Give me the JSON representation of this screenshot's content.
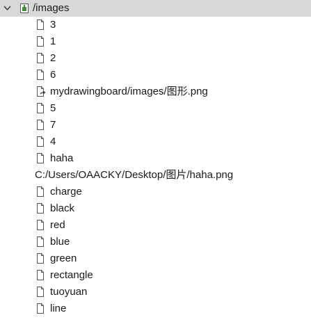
{
  "root": {
    "label": "/images",
    "icon": "folder-package-icon",
    "expanded": true
  },
  "items": [
    {
      "label": "3",
      "icon": "file-icon"
    },
    {
      "label": "1",
      "icon": "file-icon"
    },
    {
      "label": "2",
      "icon": "file-icon"
    },
    {
      "label": "6",
      "icon": "file-icon"
    },
    {
      "label": "mydrawingboard/images/图形.png",
      "icon": "file-link-icon"
    },
    {
      "label": "5",
      "icon": "file-icon"
    },
    {
      "label": "7",
      "icon": "file-icon"
    },
    {
      "label": "4",
      "icon": "file-icon"
    },
    {
      "label": "haha",
      "icon": "file-icon"
    },
    {
      "label": "C:/Users/OAACKY/Desktop/图片/haha.png",
      "icon": ""
    },
    {
      "label": "charge",
      "icon": "file-icon"
    },
    {
      "label": "black",
      "icon": "file-icon"
    },
    {
      "label": "red",
      "icon": "file-icon"
    },
    {
      "label": "blue",
      "icon": "file-icon"
    },
    {
      "label": "green",
      "icon": "file-icon"
    },
    {
      "label": "rectangle",
      "icon": "file-icon"
    },
    {
      "label": "tuoyuan",
      "icon": "file-icon"
    },
    {
      "label": "line",
      "icon": "file-icon"
    }
  ],
  "colors": {
    "selected_row_bg": "#d9d9d9",
    "text": "#1a1a1a",
    "icon_stroke": "#555555",
    "folder_accent": "#3c8d3c"
  }
}
